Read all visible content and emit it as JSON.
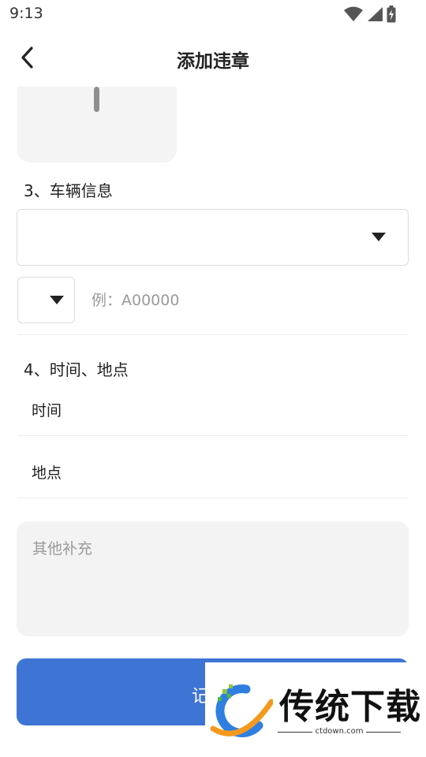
{
  "status_bar": {
    "time": "9:13"
  },
  "header": {
    "title": "添加违章"
  },
  "section_vehicle": {
    "label": "3、车辆信息",
    "plate_placeholder": "例：A00000"
  },
  "section_time_place": {
    "label": "4、时间、地点",
    "time_label": "时间",
    "place_label": "地点"
  },
  "notes": {
    "placeholder": "其他补充"
  },
  "submit": {
    "label": "记"
  },
  "watermark": {
    "text": "传统下载",
    "url": "ctdown.com"
  },
  "colors": {
    "accent": "#3e74d4",
    "field_bg": "#f3f3f3"
  }
}
